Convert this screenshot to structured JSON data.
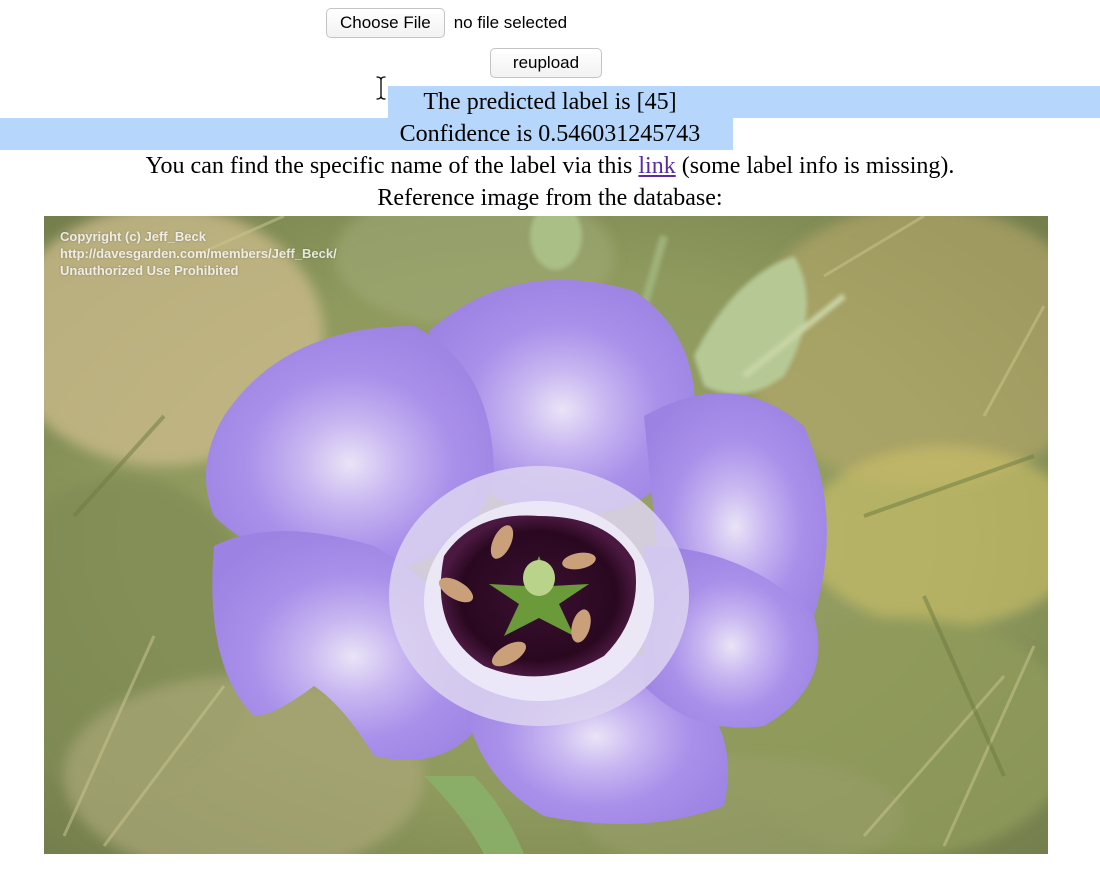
{
  "upload": {
    "choose_label": "Choose File",
    "file_status": "no file selected",
    "reupload_label": "reupload"
  },
  "result": {
    "predicted_label_text": "The predicted label is [45]",
    "confidence_text": "Confidence is 0.546031245743",
    "info_prefix": "You can find the specific name of the label via this ",
    "link_text": "link",
    "info_suffix": " (some label info is missing).",
    "reference_heading": "Reference image from the database:"
  },
  "reference_image": {
    "watermark_lines": [
      "Copyright (c) Jeff_Beck",
      "http://davesgarden.com/members/Jeff_Beck/",
      "Unauthorized Use Prohibited"
    ]
  },
  "colors": {
    "selection": "#b6d7fb",
    "link": "#5a2ba0",
    "petal": "#a98fe8"
  }
}
